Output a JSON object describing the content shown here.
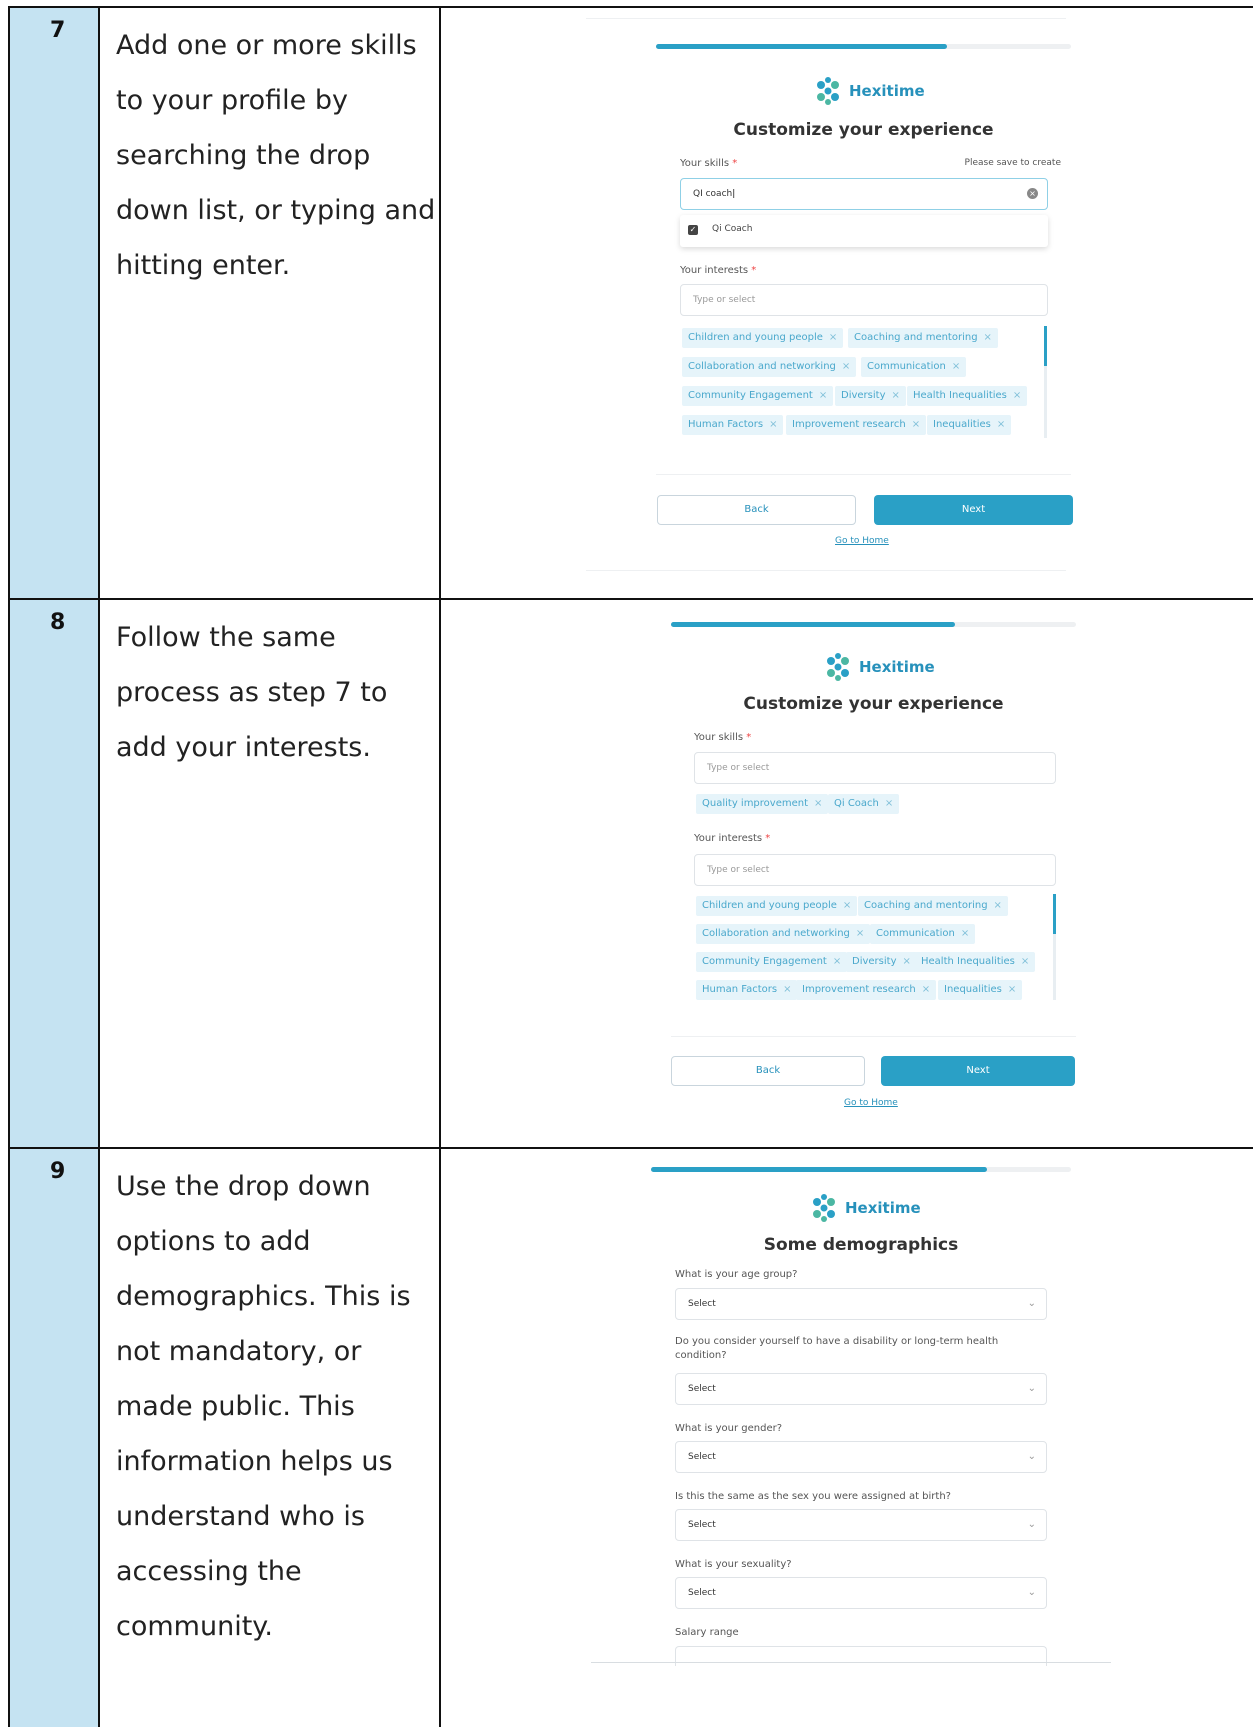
{
  "rows": [
    {
      "number": "7",
      "description": "Add one or more skills to your profile by searching the drop down list, or typing and hitting enter.",
      "screenshot": {
        "progress": 0.7,
        "brand": "Hexitime",
        "heading": "Customize your experience",
        "skills_label": "Your skills",
        "required_mark": "*",
        "save_hint": "Please save to create",
        "skills_input_value": "QI coach",
        "dropdown_option": "Qi Coach",
        "interests_label": "Your interests",
        "interests_placeholder": "Type or select",
        "interest_chips": [
          "Children and young people",
          "Coaching and mentoring",
          "Collaboration and networking",
          "Communication",
          "Community Engagement",
          "Diversity",
          "Health Inequalities",
          "Human Factors",
          "Improvement research",
          "Inequalities"
        ],
        "back_label": "Back",
        "next_label": "Next",
        "home_link": "Go to Home"
      }
    },
    {
      "number": "8",
      "description": "Follow the same process as step 7 to add your interests.",
      "screenshot": {
        "progress": 0.7,
        "brand": "Hexitime",
        "heading": "Customize your experience",
        "skills_label": "Your skills",
        "required_mark": "*",
        "skills_placeholder": "Type or select",
        "skill_chips": [
          "Quality improvement",
          "Qi Coach"
        ],
        "interests_label": "Your interests",
        "interests_placeholder": "Type or select",
        "interest_chips": [
          "Children and young people",
          "Coaching and mentoring",
          "Collaboration and networking",
          "Communication",
          "Community Engagement",
          "Diversity",
          "Health Inequalities",
          "Human Factors",
          "Improvement research",
          "Inequalities"
        ],
        "back_label": "Back",
        "next_label": "Next",
        "home_link": "Go to Home"
      }
    },
    {
      "number": "9",
      "description": "Use the drop down options to add demographics. This is not mandatory, or made public. This information helps us understand who is accessing the community.",
      "screenshot": {
        "progress": 0.8,
        "brand": "Hexitime",
        "heading": "Some demographics",
        "questions": [
          "What is your age group?",
          "Do you consider yourself to have a disability or long-term health condition?",
          "What is your gender?",
          "Is this the same as the sex you were assigned at birth?",
          "What is your sexuality?"
        ],
        "select_placeholder": "Select",
        "salary_label": "Salary range"
      }
    }
  ]
}
